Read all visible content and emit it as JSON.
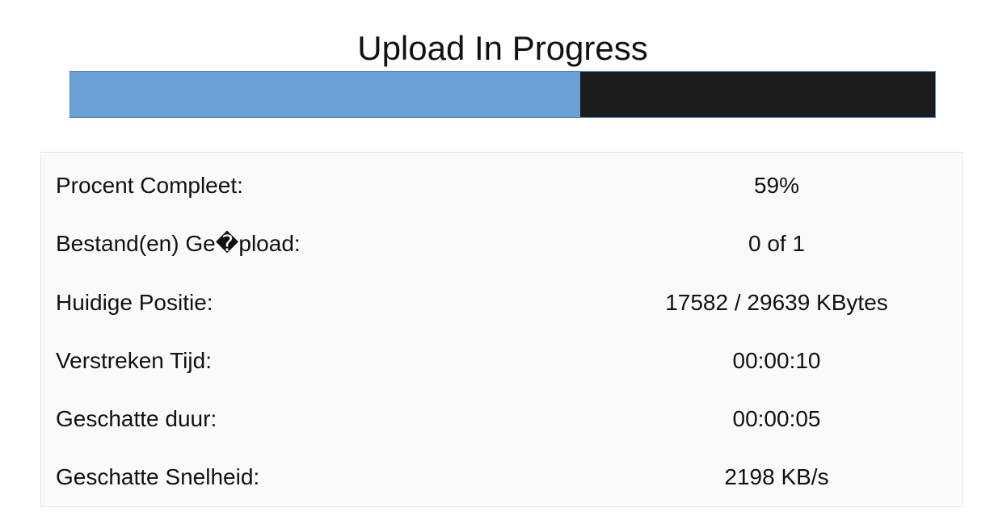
{
  "title": "Upload In Progress",
  "progress": {
    "percent": 59,
    "fill_color": "#6aa2d6",
    "track_color": "#1c1c1c"
  },
  "stats": [
    {
      "label": "Procent Compleet:",
      "value": "59%"
    },
    {
      "label": "Bestand(en) Ge�pload:",
      "value": "0 of 1"
    },
    {
      "label": "Huidige Positie:",
      "value": "17582 / 29639 KBytes"
    },
    {
      "label": "Verstreken Tijd:",
      "value": "00:00:10"
    },
    {
      "label": "Geschatte duur:",
      "value": "00:00:05"
    },
    {
      "label": "Geschatte Snelheid:",
      "value": "2198 KB/s"
    }
  ]
}
